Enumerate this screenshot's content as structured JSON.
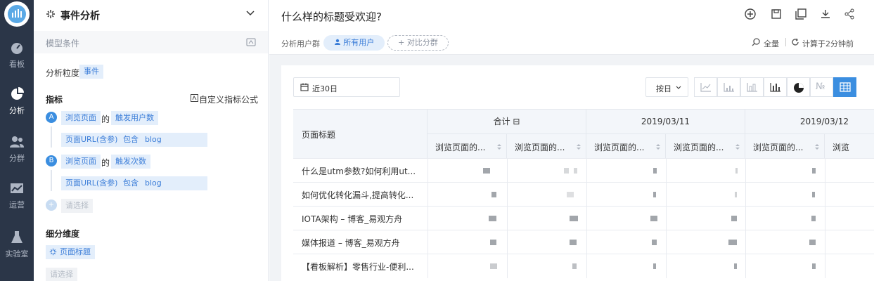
{
  "nav": {
    "items": [
      {
        "label": "看板",
        "icon": "dashboard-icon"
      },
      {
        "label": "分析",
        "icon": "pie-chart-icon",
        "active": true
      },
      {
        "label": "分群",
        "icon": "users-icon"
      },
      {
        "label": "运营",
        "icon": "line-chart-icon"
      },
      {
        "label": "实验室",
        "icon": "flask-icon"
      }
    ]
  },
  "panel": {
    "title": "事件分析",
    "model_conditions": "模型条件",
    "granularity_label": "分析粒度",
    "granularity_value": "事件",
    "metrics_label": "指标",
    "custom_formula": "自定义指标公式",
    "metric_a": {
      "badge": "A",
      "event": "浏览页面",
      "of": "的",
      "measure": "触发用户数",
      "filter": [
        "页面URL(含参)",
        "包含",
        "blog"
      ]
    },
    "metric_b": {
      "badge": "B",
      "event": "浏览页面",
      "of": "的",
      "measure": "触发次数",
      "filter": [
        "页面URL(含参)",
        "包含",
        "blog"
      ]
    },
    "add_placeholder": "请选择",
    "breakdown_label": "细分维度",
    "breakdown_value": "页面标题",
    "breakdown_placeholder": "请选择"
  },
  "main": {
    "title": "什么样的标题受欢迎?",
    "segment_label": "分析用户群",
    "segment_all": "所有用户",
    "segment_compare": "+ 对比分群",
    "full_label": "全量",
    "computed": "计算于2分钟前",
    "date_range": "近30日",
    "interval": "按日",
    "chart_types": [
      "line-chart-icon",
      "bar-chart-icon",
      "stacked-bar-icon",
      "column-chart-icon",
      "pie-chart-icon",
      "number-icon",
      "table-icon"
    ],
    "chart_number_glyph": "№",
    "active_chart": "table-icon"
  },
  "table": {
    "row_header": "页面标题",
    "groups": [
      "合计 ⊟",
      "2019/03/11",
      "2019/03/12"
    ],
    "sub_headers": [
      "浏览页面的...",
      "浏览页面的...",
      "浏览页面的...",
      "浏览页面的...",
      "浏览页面的...",
      "浏览"
    ],
    "rows": [
      "什么是utm参数?如何利用ut...",
      "如何优化转化漏斗,提高转化...",
      "IOTA架构 – 博客_易观方舟",
      "媒体报道 – 博客_易观方舟",
      "【看板解析】零售行业-便利..."
    ]
  }
}
